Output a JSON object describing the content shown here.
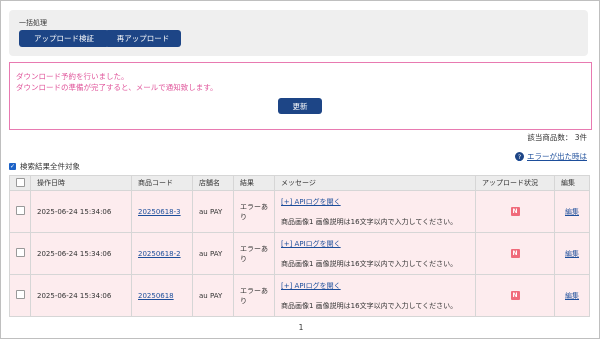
{
  "bulk": {
    "title": "一括処理",
    "verify_label": "アップロード検証",
    "reupload_label": "再アップロード"
  },
  "notice": {
    "line1": "ダウンロード予約を行いました。",
    "line2": "ダウンロードの準備が完了すると、メールで通知致します。",
    "refresh_label": "更新"
  },
  "summary": {
    "count_text": "該当商品数： 3件",
    "help_text": "エラーが出た時は",
    "help_icon": "question-icon"
  },
  "select_all": {
    "label": "検索結果全件対象"
  },
  "table": {
    "headers": [
      "操作日時",
      "商品コード",
      "店舗名",
      "結果",
      "メッセージ",
      "アップロード状況",
      "編集"
    ],
    "rows": [
      {
        "datetime": "2025-06-24 15:34:06",
        "code": "20250618-3",
        "store": "au PAY",
        "result": "エラーあり",
        "log_link": "[+] APIログを開く",
        "message": "商品画像1 画像説明は16文字以内で入力してください。",
        "status": "N",
        "edit": "編集"
      },
      {
        "datetime": "2025-06-24 15:34:06",
        "code": "20250618-2",
        "store": "au PAY",
        "result": "エラーあり",
        "log_link": "[+] APIログを開く",
        "message": "商品画像1 画像説明は16文字以内で入力してください。",
        "status": "N",
        "edit": "編集"
      },
      {
        "datetime": "2025-06-24 15:34:06",
        "code": "20250618",
        "store": "au PAY",
        "result": "エラーあり",
        "log_link": "[+] APIログを開く",
        "message": "商品画像1 画像説明は16文字以内で入力してください。",
        "status": "N",
        "edit": "編集"
      }
    ]
  },
  "pager": {
    "current": "1"
  },
  "colors": {
    "primary": "#1d4586",
    "notice_border": "#e87ab1",
    "notice_text": "#e0559b",
    "row_bg": "#fdecee",
    "badge": "#f06a7a"
  }
}
